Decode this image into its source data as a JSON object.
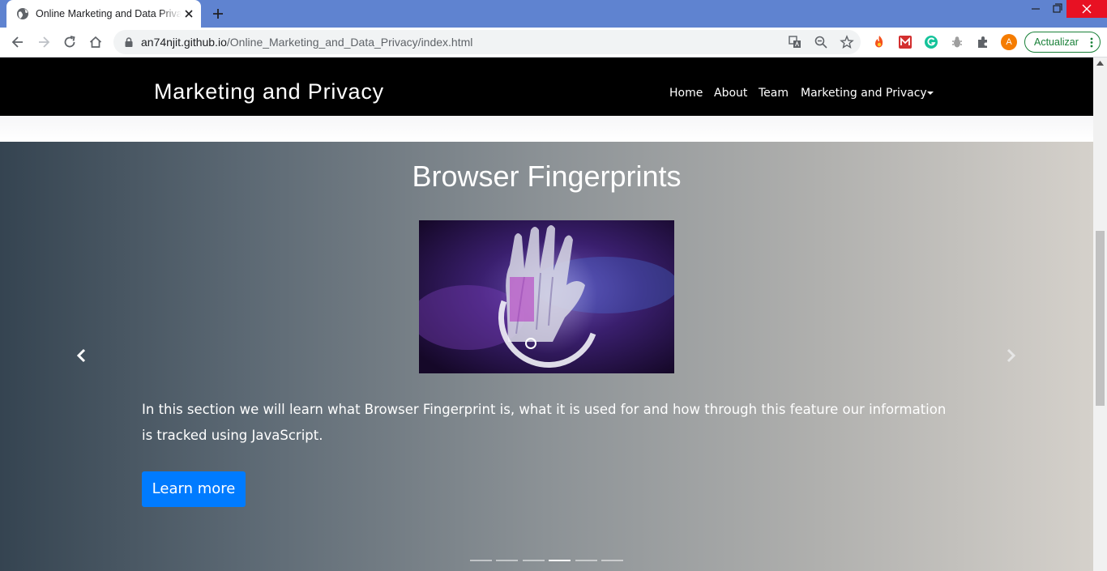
{
  "browser": {
    "tab_title": "Online Marketing and Data Privacy",
    "url_host": "an74njit.github.io",
    "url_path": "/Online_Marketing_and_Data_Privacy/index.html",
    "profile_initial": "A",
    "update_label": "Actualizar"
  },
  "navbar": {
    "brand": "Marketing and Privacy",
    "items": [
      {
        "label": "Home"
      },
      {
        "label": "About"
      },
      {
        "label": "Team"
      },
      {
        "label": "Marketing and Privacy"
      }
    ]
  },
  "carousel": {
    "title": "Browser Fingerprints",
    "text": "In this section we will learn what Browser Fingerprint is, what it is used for and how through this feature our information is tracked using JavaScript.",
    "button_label": "Learn more",
    "slide_count": 6,
    "active_index": 3
  },
  "colors": {
    "titlebar": "#5f83d0",
    "navbar": "#000000",
    "button": "#007bff",
    "update_green": "#188038"
  }
}
